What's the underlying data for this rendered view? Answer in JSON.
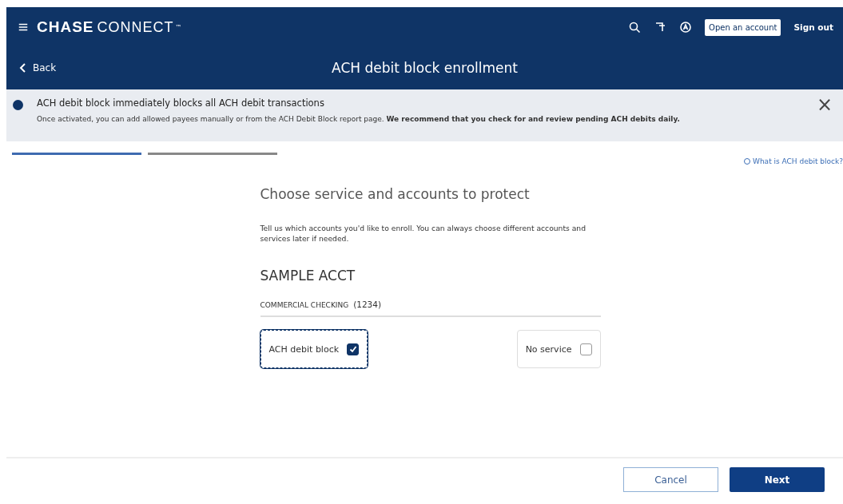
{
  "header": {
    "brand_bold": "CHASE",
    "brand_light": "CONNECT",
    "trademark": "™",
    "open_account": "Open an account",
    "sign_out": "Sign out"
  },
  "subheader": {
    "back": "Back",
    "title": "ACH debit block enrollment"
  },
  "banner": {
    "heading": "ACH debit block immediately blocks all ACH debit transactions",
    "text": "Once activated, you can add allowed payees manually or from the ACH Debit Block report page. **We recommend that you check for and review pending ACH debits daily.**",
    "close": "×"
  },
  "steps": [
    {
      "selected": true
    },
    {
      "selected": false
    }
  ],
  "help_link": "What is ACH debit block?",
  "content": {
    "title": "Choose service and accounts to protect",
    "intro": "Tell us which accounts you'd like to enroll. You can always choose different accounts and services later if needed.",
    "account_name": "SAMPLE ACCT",
    "account_type": "COMMERCIAL CHECKING",
    "account_number": "(1234)",
    "options": [
      {
        "label": "ACH debit block",
        "checked": true,
        "selected": true
      },
      {
        "label": "No service",
        "checked": false,
        "selected": false
      }
    ]
  },
  "footer": {
    "cancel": "Cancel",
    "next": "Next"
  }
}
